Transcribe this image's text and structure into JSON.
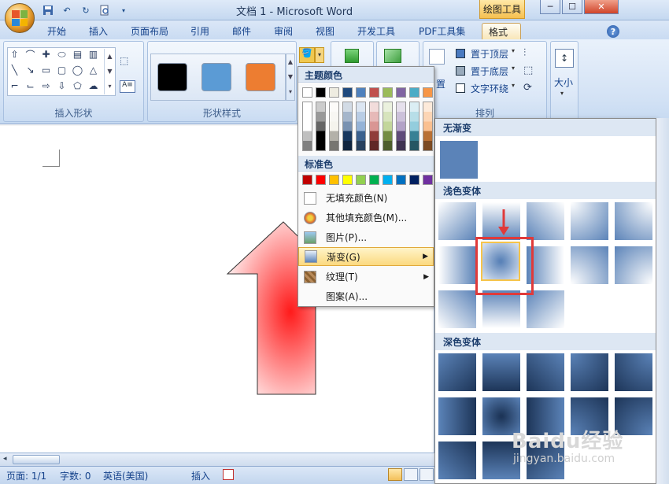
{
  "window": {
    "title": "文档 1 - Microsoft Word",
    "context_tab": "绘图工具",
    "controls": {
      "minimize": "─",
      "maximize": "☐",
      "close": "✕"
    }
  },
  "quick_access": {
    "save_icon": "save-icon",
    "undo_icon": "undo-icon",
    "redo_icon": "redo-icon",
    "print_preview_icon": "print-preview-icon"
  },
  "tabs": [
    "开始",
    "插入",
    "页面布局",
    "引用",
    "邮件",
    "审阅",
    "视图",
    "开发工具",
    "PDF工具集",
    "格式"
  ],
  "active_tab": "格式",
  "ribbon": {
    "groups": {
      "insert_shapes": "插入形状",
      "shape_styles": "形状样式",
      "arrange": "排列"
    },
    "arrange": {
      "bring_front": "置于顶层",
      "send_back": "置于底层",
      "text_wrap": "文字环绕",
      "position_partial": "置"
    },
    "size_label": "大小",
    "style_colors": [
      "#000000",
      "#5b9bd5",
      "#ed7d31"
    ]
  },
  "fill_menu": {
    "theme_colors_header": "主题颜色",
    "standard_colors_header": "标准色",
    "theme_top_row": [
      "#ffffff",
      "#000000",
      "#eeece1",
      "#1f497d",
      "#4f81bd",
      "#c0504d",
      "#9bbb59",
      "#8064a2",
      "#4bacc6",
      "#f79646"
    ],
    "standard_colors": [
      "#c00000",
      "#ff0000",
      "#ffc000",
      "#ffff00",
      "#92d050",
      "#00b050",
      "#00b0f0",
      "#0070c0",
      "#002060",
      "#7030a0"
    ],
    "items": [
      {
        "label": "无填充颜色(N)",
        "icon": "no-fill-icon"
      },
      {
        "label": "其他填充颜色(M)...",
        "icon": "palette-icon"
      },
      {
        "label": "图片(P)...",
        "icon": "picture-icon"
      },
      {
        "label": "渐变(G)",
        "icon": "gradient-icon",
        "submenu": true
      },
      {
        "label": "纹理(T)",
        "icon": "texture-icon",
        "submenu": true
      },
      {
        "label": "图案(A)...",
        "icon": "pattern-icon"
      }
    ]
  },
  "gradient_panel": {
    "no_gradient": "无渐变",
    "light_variants": "浅色变体",
    "dark_variants": "深色变体",
    "base_color": "#5b83b8"
  },
  "status": {
    "page": "页面: 1/1",
    "words": "字数: 0",
    "language": "英语(美国)",
    "mode": "插入"
  },
  "watermark": {
    "brand": "Baidu经验",
    "url": "jingyan.baidu.com"
  }
}
